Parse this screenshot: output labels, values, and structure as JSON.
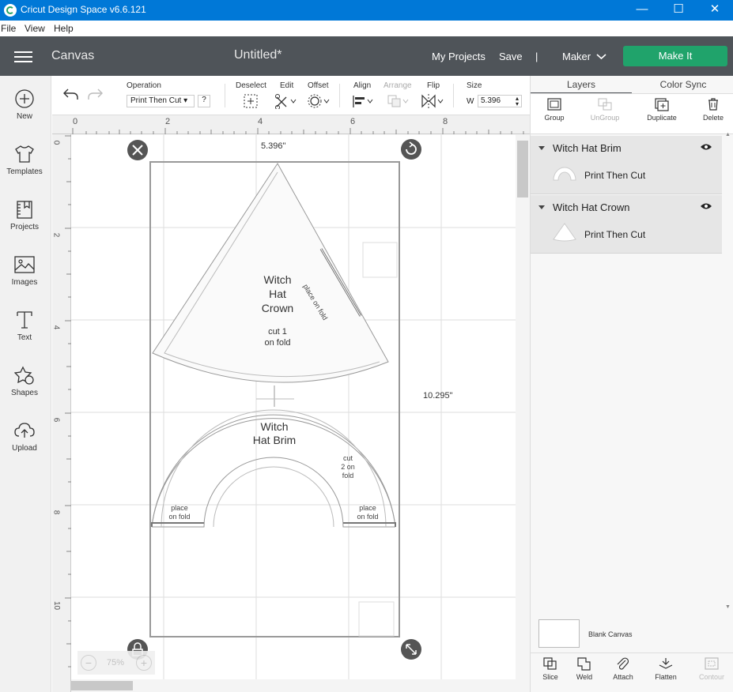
{
  "window": {
    "title": "Cricut Design Space  v6.6.121",
    "minimize": "—",
    "maximize": "☐",
    "close": "✕"
  },
  "menu": [
    "File",
    "View",
    "Help"
  ],
  "header": {
    "section": "Canvas",
    "document": "Untitled*",
    "my_projects": "My Projects",
    "save": "Save",
    "separator": "|",
    "machine": "Maker",
    "make_it": "Make It"
  },
  "sidebar": [
    {
      "label": "New",
      "icon": "plus-circle-icon"
    },
    {
      "label": "Templates",
      "icon": "shirt-icon"
    },
    {
      "label": "Projects",
      "icon": "projects-icon"
    },
    {
      "label": "Images",
      "icon": "image-icon"
    },
    {
      "label": "Text",
      "icon": "text-icon"
    },
    {
      "label": "Shapes",
      "icon": "shapes-icon"
    },
    {
      "label": "Upload",
      "icon": "cloud-upload-icon"
    }
  ],
  "toolbar": {
    "operation_label": "Operation",
    "operation_value": "Print Then Cut",
    "help": "?",
    "deselect": "Deselect",
    "edit": "Edit",
    "offset": "Offset",
    "align": "Align",
    "arrange": "Arrange",
    "flip": "Flip",
    "size_label": "Size",
    "size_w_label": "W",
    "size_w_value": "5.396"
  },
  "ruler": {
    "top": [
      "0",
      "2",
      "4",
      "6",
      "8"
    ],
    "left": [
      "0",
      "2",
      "4",
      "6",
      "8",
      "10"
    ]
  },
  "canvas": {
    "width_label": "5.396\"",
    "height_label": "10.295\"",
    "crown_title": [
      "Witch",
      "Hat",
      "Crown"
    ],
    "crown_cut": [
      "cut 1",
      "on fold"
    ],
    "crown_fold": "place on fold",
    "brim_title": [
      "Witch",
      "Hat Brim"
    ],
    "brim_cut": [
      "cut",
      "2 on",
      "fold"
    ],
    "brim_fold_left": [
      "place",
      "on fold"
    ],
    "brim_fold_right": [
      "place",
      "on fold"
    ]
  },
  "zoom": {
    "minus": "−",
    "value": "75%",
    "plus": "+"
  },
  "panel": {
    "tabs": [
      "Layers",
      "Color Sync"
    ],
    "actions": [
      "Group",
      "UnGroup",
      "Duplicate",
      "Delete"
    ],
    "layers": [
      {
        "name": "Witch Hat Brim",
        "sub": "Print Then Cut"
      },
      {
        "name": "Witch Hat Crown",
        "sub": "Print Then Cut"
      }
    ],
    "blank_canvas": "Blank Canvas",
    "bottom": [
      "Slice",
      "Weld",
      "Attach",
      "Flatten",
      "Contour"
    ]
  }
}
